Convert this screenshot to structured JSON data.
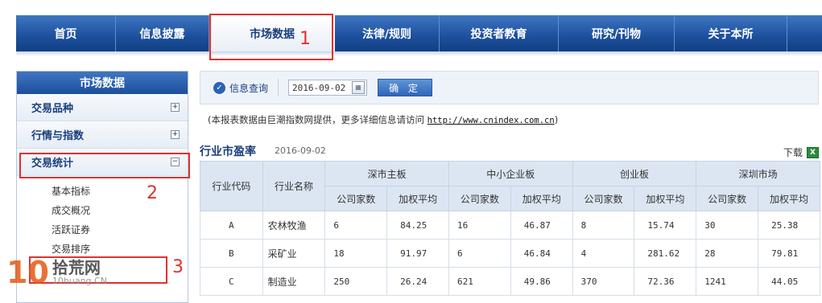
{
  "nav": {
    "items": [
      "首页",
      "信息披露",
      "市场数据",
      "法律/规则",
      "投资者教育",
      "研究/刊物",
      "关于本所"
    ],
    "active_index": 2
  },
  "annotations": [
    "1",
    "2",
    "3"
  ],
  "sidebar": {
    "title": "市场数据",
    "categories": [
      {
        "label": "交易品种",
        "toggle": "+"
      },
      {
        "label": "行情与指数",
        "toggle": "+"
      },
      {
        "label": "交易统计",
        "toggle": "−"
      }
    ],
    "subitems": [
      "基本指标",
      "成交概况",
      "活跃证券",
      "交易排序"
    ]
  },
  "query": {
    "label": "信息查询",
    "date_value": "2016-09-02",
    "button_label": "确 定"
  },
  "notice": {
    "prefix": "(本报表数据由巨潮指数网提供，更多详细信息请访问 ",
    "link": "http://www.cnindex.com.cn",
    "suffix": ")"
  },
  "section": {
    "title": "行业市盈率",
    "date": "2016-09-02",
    "download_label": "下载"
  },
  "table": {
    "col_code": "行业代码",
    "col_name": "行业名称",
    "groups": [
      "深市主板",
      "中小企业板",
      "创业板",
      "深圳市场"
    ],
    "sub_headers": [
      "公司家数",
      "加权平均"
    ],
    "rows": [
      {
        "code": "A",
        "name": "农林牧渔",
        "vals": [
          "6",
          "84.25",
          "16",
          "46.87",
          "8",
          "15.74",
          "30",
          "25.38"
        ]
      },
      {
        "code": "B",
        "name": "采矿业",
        "vals": [
          "18",
          "91.97",
          "6",
          "46.84",
          "4",
          "281.62",
          "28",
          "79.81"
        ]
      },
      {
        "code": "C",
        "name": "制造业",
        "vals": [
          "250",
          "26.24",
          "621",
          "49.86",
          "370",
          "72.36",
          "1241",
          "44.05"
        ]
      }
    ]
  },
  "watermark": {
    "number": "10",
    "cn": "拾荒网",
    "en": "10huang.CN"
  }
}
